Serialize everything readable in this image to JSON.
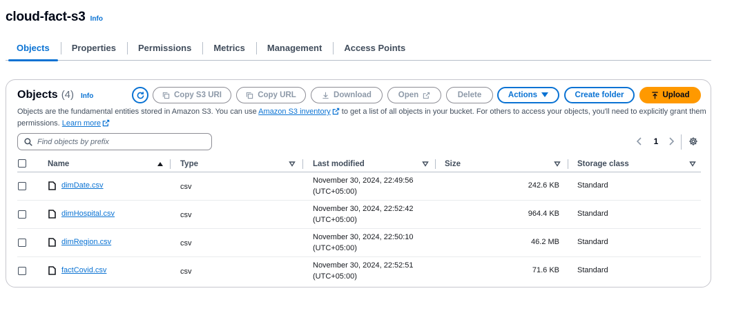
{
  "header": {
    "bucket_name": "cloud-fact-s3",
    "info_label": "Info"
  },
  "tabs": [
    {
      "label": "Objects",
      "active": true
    },
    {
      "label": "Properties",
      "active": false
    },
    {
      "label": "Permissions",
      "active": false
    },
    {
      "label": "Metrics",
      "active": false
    },
    {
      "label": "Management",
      "active": false
    },
    {
      "label": "Access Points",
      "active": false
    }
  ],
  "objects_panel": {
    "title": "Objects",
    "count": "(4)",
    "info_label": "Info",
    "buttons": {
      "copy_s3_uri": "Copy S3 URI",
      "copy_url": "Copy URL",
      "download": "Download",
      "open": "Open",
      "delete": "Delete",
      "actions": "Actions",
      "create_folder": "Create folder",
      "upload": "Upload"
    },
    "description": {
      "part1": "Objects are the fundamental entities stored in Amazon S3. You can use ",
      "link1": "Amazon S3 inventory",
      "part2": " to get a list of all objects in your bucket. For others to access your objects, you'll need to explicitly grant them permissions. ",
      "link2": "Learn more"
    },
    "search": {
      "placeholder": "Find objects by prefix",
      "value": ""
    },
    "pagination": {
      "current_page": "1"
    },
    "columns": {
      "name": "Name",
      "type": "Type",
      "last_modified": "Last modified",
      "size": "Size",
      "storage_class": "Storage class"
    },
    "rows": [
      {
        "name": "dimDate.csv",
        "type": "csv",
        "modified_date": "November 30, 2024, 22:49:56",
        "modified_tz": "(UTC+05:00)",
        "size": "242.6 KB",
        "storage_class": "Standard"
      },
      {
        "name": "dimHospital.csv",
        "type": "csv",
        "modified_date": "November 30, 2024, 22:52:42",
        "modified_tz": "(UTC+05:00)",
        "size": "964.4 KB",
        "storage_class": "Standard"
      },
      {
        "name": "dimRegion.csv",
        "type": "csv",
        "modified_date": "November 30, 2024, 22:50:10",
        "modified_tz": "(UTC+05:00)",
        "size": "46.2 MB",
        "storage_class": "Standard"
      },
      {
        "name": "factCovid.csv",
        "type": "csv",
        "modified_date": "November 30, 2024, 22:52:51",
        "modified_tz": "(UTC+05:00)",
        "size": "71.6 KB",
        "storage_class": "Standard"
      }
    ]
  },
  "colors": {
    "link_blue": "#0972d3",
    "upload_orange": "#ff9900",
    "disabled_text": "#8d99a8"
  }
}
